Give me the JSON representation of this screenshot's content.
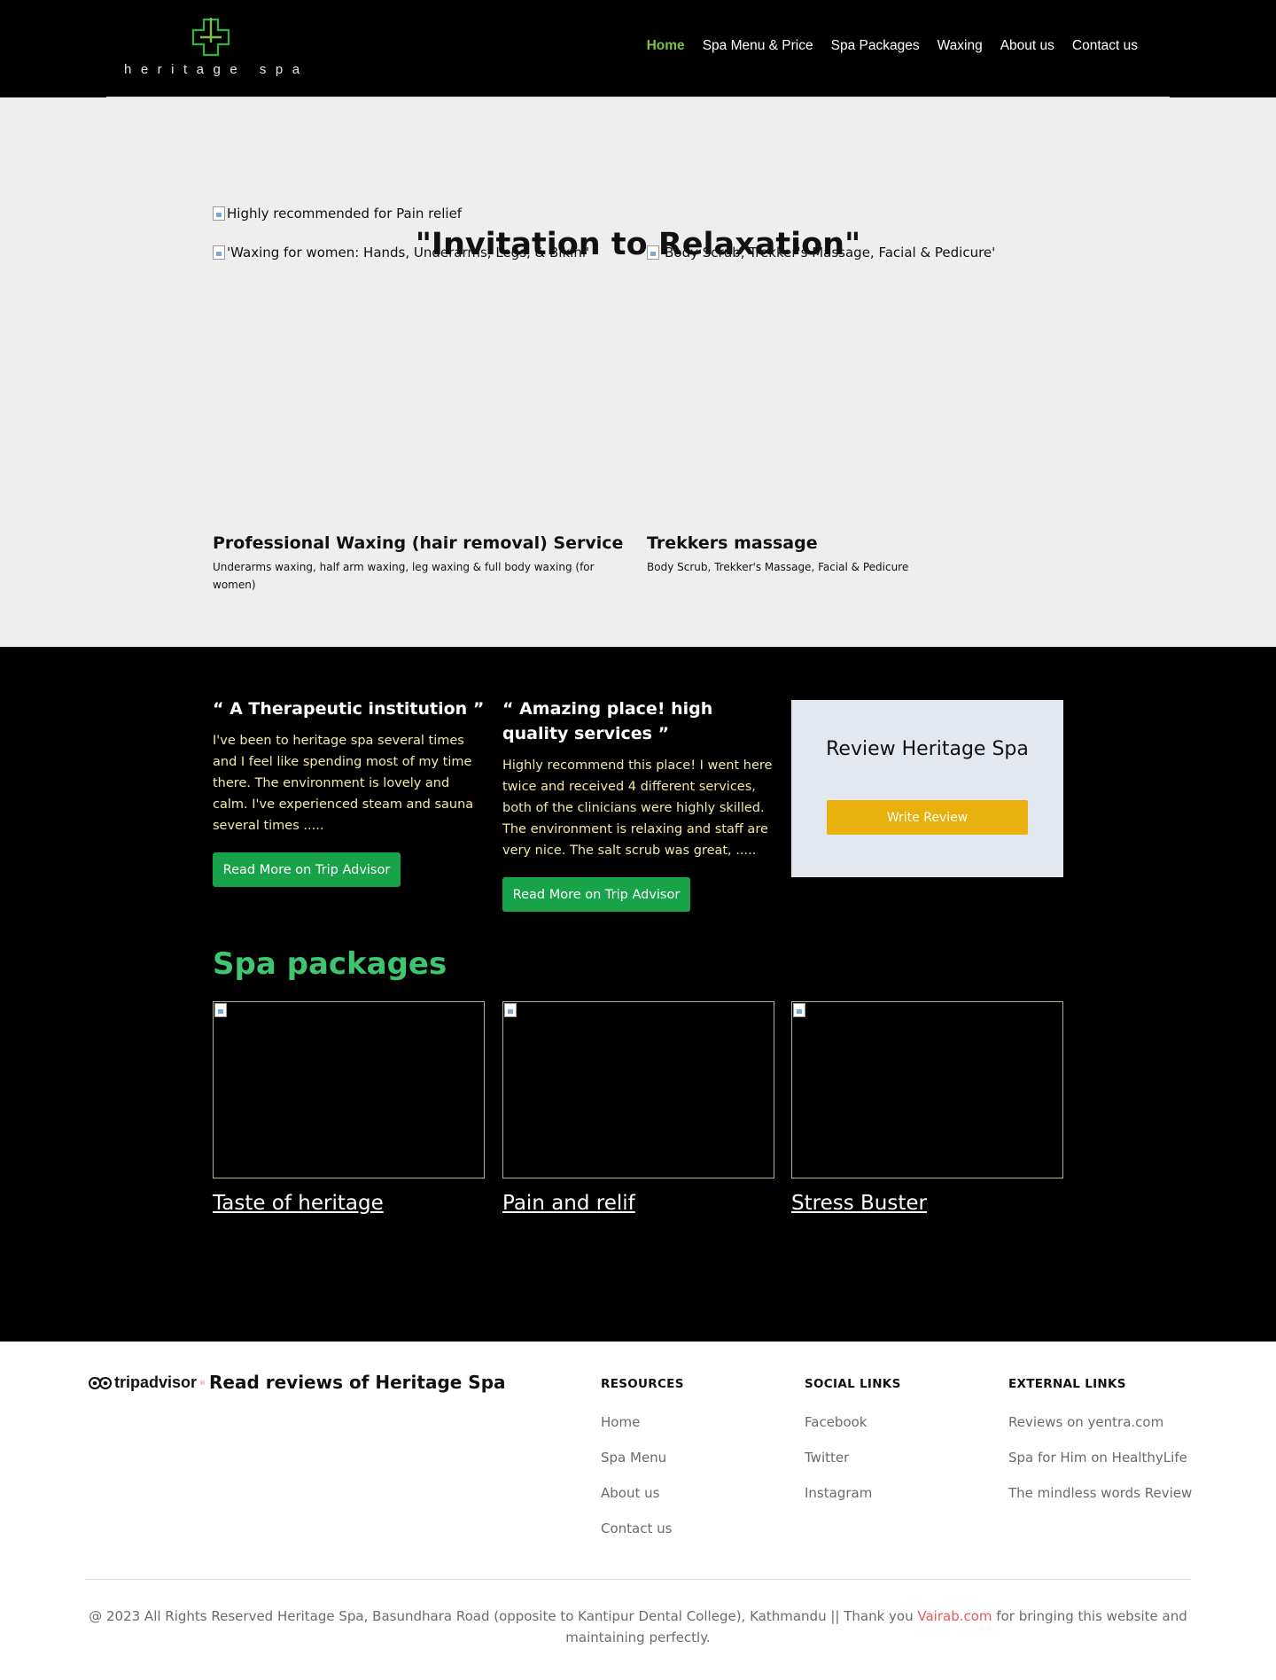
{
  "header": {
    "logo_text": "heritage spa",
    "nav": [
      {
        "label": "Home",
        "active": true
      },
      {
        "label": "Spa Menu & Price",
        "active": false
      },
      {
        "label": "Spa Packages",
        "active": false
      },
      {
        "label": "Waxing",
        "active": false
      },
      {
        "label": "About us",
        "active": false
      },
      {
        "label": "Contact us",
        "active": false
      }
    ]
  },
  "intro": {
    "title": "\"Invitation to Relaxation\"",
    "banner_alt": "Highly recommended for Pain relief",
    "services": [
      {
        "image_alt": "'Waxing for women: Hands, Underarms, Legs, & Bikini'",
        "title": "Professional Waxing (hair removal) Service",
        "description": "Underarms waxing, half arm waxing, leg waxing & full body waxing (for women)"
      },
      {
        "image_alt": "'Body Scrub, Trekker's Massage, Facial & Pedicure'",
        "title": "Trekkers massage",
        "description": "Body Scrub, Trekker's Massage, Facial & Pedicure"
      }
    ]
  },
  "reviews": {
    "quotes": [
      {
        "heading": "“ A Therapeutic institution ”",
        "text": "I've been to heritage spa several times and I feel like spending most of my time there. The environment is lovely and calm. I've experienced steam and sauna several times .....",
        "button": "Read More on Trip Advisor"
      },
      {
        "heading": "“ Amazing place! high quality services ”",
        "text": "Highly recommend this place! I went here twice and received 4 different services, both of the clinicians were highly skilled. The environment is relaxing and staff are very nice. The salt scrub was great, .....",
        "button": "Read More on Trip Advisor"
      }
    ],
    "review_box": {
      "title": "Review Heritage Spa",
      "button": "Write Review"
    }
  },
  "packages": {
    "heading": "Spa packages",
    "items": [
      {
        "name": "Taste of heritage"
      },
      {
        "name": "Pain and relif"
      },
      {
        "name": "Stress Buster"
      }
    ]
  },
  "footer": {
    "tripadvisor_logo": {
      "trip": "trip",
      "advisor": "advisor",
      "tm": "®"
    },
    "read_reviews": "Read reviews of Heritage Spa",
    "resources": {
      "title": "RESOURCES",
      "links": [
        "Home",
        "Spa Menu",
        "About us",
        "Contact us"
      ]
    },
    "social": {
      "title": "SOCIAL LINKS",
      "links": [
        "Facebook",
        "Twitter",
        "Instagram"
      ]
    },
    "external": {
      "title": "EXTERNAL LINKS",
      "links": [
        "Reviews on yentra.com",
        "Spa for Him on HealthyLife",
        "The mindless words Review"
      ]
    },
    "copyright_before": "@ 2023 All Rights Reserved Heritage Spa, Basundhara Road (opposite to Kantipur Dental College), Kathmandu || Thank you ",
    "copyright_link": "Vairab.com",
    "copyright_after": " for bringing this website and maintaining perfectly."
  },
  "colors": {
    "header_bg": "#000000",
    "nav_active": "#7fc142",
    "intro_bg": "#eeeeee",
    "dark_bg": "#000000",
    "quote_text": "#f3e7a6",
    "button_green": "#18a34a",
    "button_yellow": "#e9b10d",
    "packages_heading": "#3fc56f",
    "review_box_bg": "#e3e8f0",
    "footer_link": "#6b6b6b",
    "credit_link": "#e8595a"
  }
}
